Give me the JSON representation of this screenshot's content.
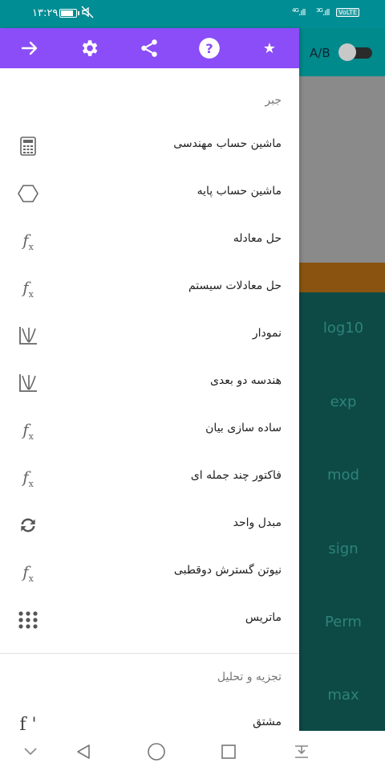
{
  "status_bar": {
    "time": "۱۳:۲۹",
    "signal_1_label": "4G",
    "signal_2_label": "3G",
    "volte": "VoLTE",
    "colors": {
      "background": "#008d93"
    }
  },
  "background_app": {
    "toggle_label": "A/B",
    "keys": [
      "log10",
      "exp",
      "mod",
      "sign",
      "Perm",
      "max"
    ],
    "colors": {
      "topbar": "#008a8c",
      "display": "#8a8a8a",
      "orange_bar": "#8a5410",
      "keypad": "#0d4a46",
      "key_text": "#2e827a"
    }
  },
  "drawer": {
    "header": {
      "icons": [
        "arrow-right-icon",
        "gear-icon",
        "share-icon",
        "help-icon",
        "star-icon"
      ],
      "star_glyph": "★",
      "colors": {
        "background": "#8a4df7",
        "icon": "#ffffff"
      }
    },
    "sections": [
      {
        "title": "جبر",
        "items": [
          {
            "label": "ماشین حساب مهندسی",
            "icon": "calculator-icon"
          },
          {
            "label": "ماشین حساب پایه",
            "icon": "hexagon-icon"
          },
          {
            "label": "حل معادله",
            "icon": "function-icon"
          },
          {
            "label": "حل معادلات سیستم",
            "icon": "function-icon"
          },
          {
            "label": "نمودار",
            "icon": "graph-icon"
          },
          {
            "label": "هندسه دو بعدی",
            "icon": "graph-icon"
          },
          {
            "label": "ساده سازی بیان",
            "icon": "function-icon"
          },
          {
            "label": "فاکتور چند جمله ای",
            "icon": "function-icon"
          },
          {
            "label": "مبدل واحد",
            "icon": "convert-icon"
          },
          {
            "label": "نیوتن گسترش دوقطبی",
            "icon": "function-icon"
          },
          {
            "label": "ماتریس",
            "icon": "matrix-icon"
          }
        ]
      },
      {
        "title": "تجزیه و تحلیل",
        "items": [
          {
            "label": "مشتق",
            "icon": "derivative-icon",
            "glyph": "f '"
          }
        ]
      }
    ],
    "fx_glyph": "f",
    "fx_sub": "x"
  },
  "nav_bar": {
    "buttons": [
      "collapse-icon",
      "back-icon",
      "home-icon",
      "recents-icon",
      "notification-pull-icon"
    ]
  }
}
